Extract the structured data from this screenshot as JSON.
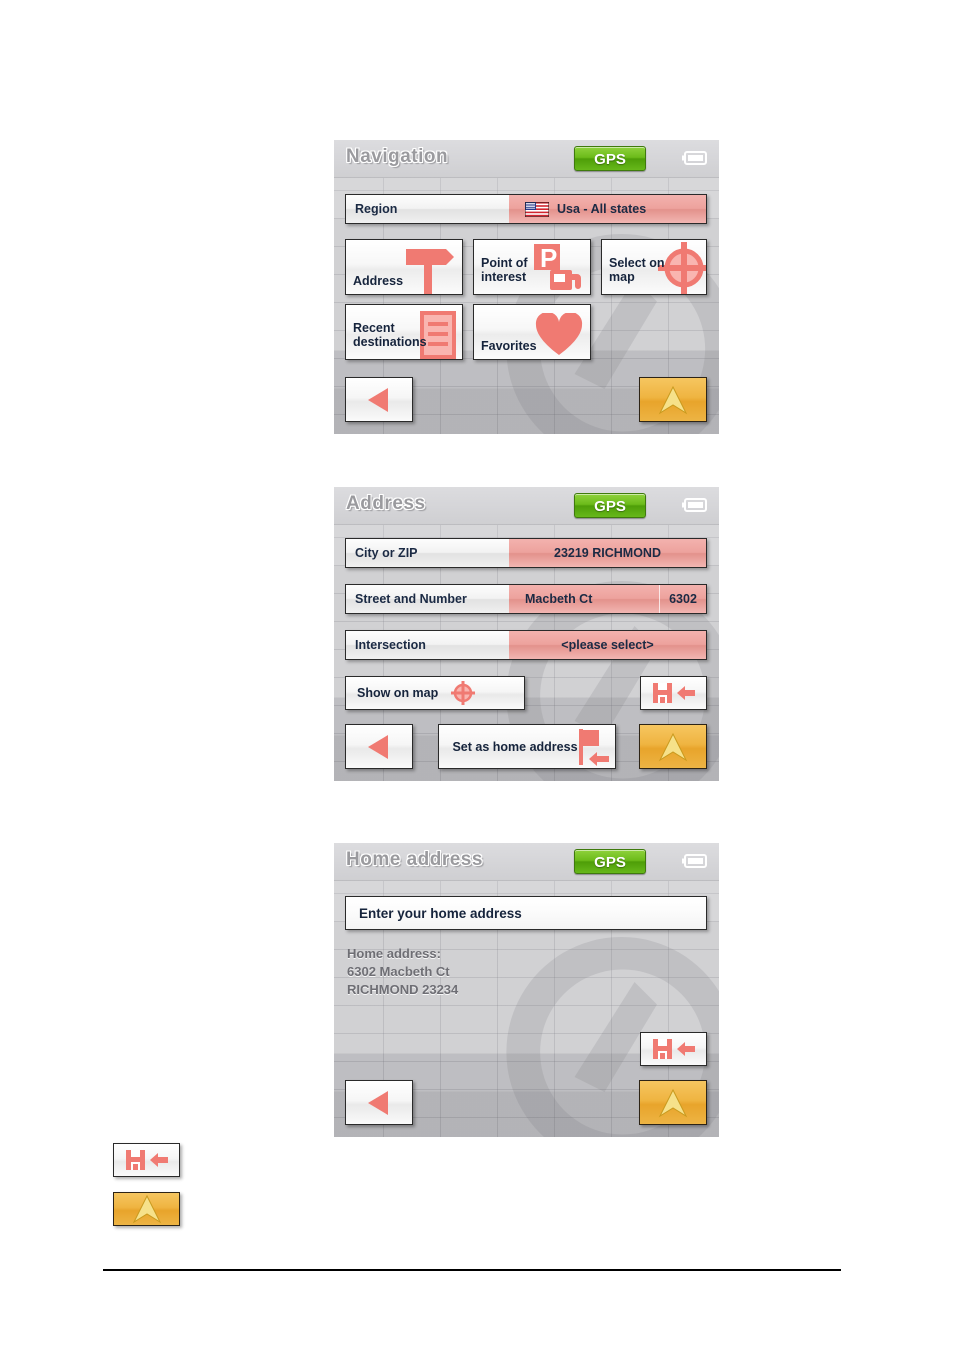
{
  "document": {
    "panels": [
      {
        "id": "navigation",
        "title": "Navigation",
        "status": {
          "gps_label": "GPS",
          "battery_icon": "battery-icon"
        },
        "region_row": {
          "label": "Region",
          "value": "Usa - All states",
          "flag_icon": "usa-flag-icon"
        },
        "tiles": [
          {
            "label": "Address",
            "icon": "signpost-icon"
          },
          {
            "label": "Point of\ninterest",
            "icon": "parking-fuel-icon"
          },
          {
            "label": "Select on\nmap",
            "icon": "crosshair-icon"
          },
          {
            "label": "Recent\ndestinations",
            "icon": "list-document-icon"
          },
          {
            "label": "Favorites",
            "icon": "heart-icon"
          }
        ],
        "nav": {
          "back_icon": "back-arrow-icon",
          "navigate_icon": "navigate-arrow-icon"
        }
      },
      {
        "id": "address",
        "title": "Address",
        "status": {
          "gps_label": "GPS",
          "battery_icon": "battery-icon"
        },
        "rows": [
          {
            "label": "City or ZIP",
            "value": "23219 RICHMOND",
            "number": ""
          },
          {
            "label": "Street and Number",
            "value": "Macbeth Ct",
            "number": "6302"
          },
          {
            "label": "Intersection",
            "value": "<please select>",
            "number": ""
          }
        ],
        "show_on_map": {
          "label": "Show on map",
          "icon": "crosshair-icon"
        },
        "save_button": {
          "icon": "save-floppy-arrow-icon"
        },
        "set_home": {
          "label": "Set as home address",
          "icon": "home-save-icon"
        },
        "nav": {
          "back_icon": "back-arrow-icon",
          "navigate_icon": "navigate-arrow-icon"
        }
      },
      {
        "id": "home-address",
        "title": "Home address",
        "status": {
          "gps_label": "GPS",
          "battery_icon": "battery-icon"
        },
        "prompt": "Enter your home address",
        "home_address_block": "Home address:\n6302 Macbeth Ct\nRICHMOND 23234",
        "save_button": {
          "icon": "save-floppy-arrow-icon"
        },
        "nav": {
          "back_icon": "back-arrow-icon",
          "navigate_icon": "navigate-arrow-icon"
        }
      }
    ],
    "legend": [
      {
        "icon": "save-floppy-arrow-icon"
      },
      {
        "icon": "navigate-arrow-icon"
      }
    ],
    "colors": {
      "accent_red": "#f07a72",
      "value_field": "#eda29d",
      "gps_green": "#6cbb1a",
      "gold": "#efb441",
      "panel_bg": "#c8c8cb",
      "text_dark": "#16243c"
    }
  }
}
